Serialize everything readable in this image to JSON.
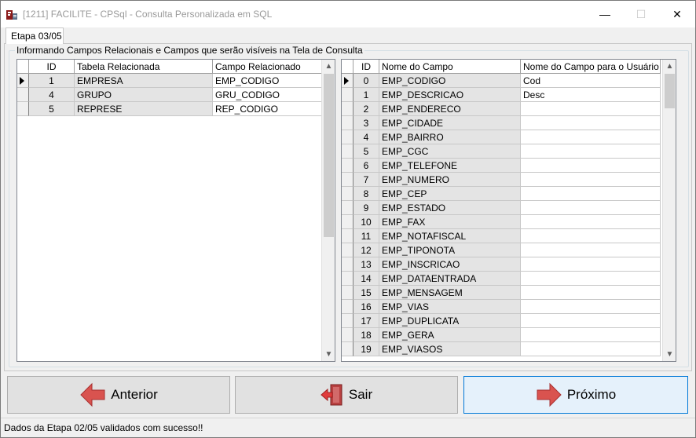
{
  "window": {
    "title": "[1211] FACILITE - CPSql - Consulta Personalizada em SQL",
    "minimize_glyph": "—",
    "maximize_glyph": "☐",
    "close_glyph": "✕",
    "app_icon": "facilite-app-icon"
  },
  "tab": {
    "label": "Etapa 03/05"
  },
  "group": {
    "caption": "Informando Campos Relacionais e Campos que serão visíveis na Tela de Consulta"
  },
  "left_grid": {
    "headers": [
      "ID",
      "Tabela Relacionada",
      "Campo Relacionado"
    ],
    "rows": [
      {
        "id": "1",
        "tabela": "EMPRESA",
        "campo": "EMP_CODIGO",
        "current": true
      },
      {
        "id": "4",
        "tabela": "GRUPO",
        "campo": "GRU_CODIGO",
        "current": false
      },
      {
        "id": "5",
        "tabela": "REPRESE",
        "campo": "REP_CODIGO",
        "current": false
      }
    ]
  },
  "right_grid": {
    "headers": [
      "ID",
      "Nome do Campo",
      "Nome do Campo para o Usuário"
    ],
    "rows": [
      {
        "id": "0",
        "nome": "EMP_CODIGO",
        "usuario": "Cod",
        "current": true
      },
      {
        "id": "1",
        "nome": "EMP_DESCRICAO",
        "usuario": "Desc",
        "current": false
      },
      {
        "id": "2",
        "nome": "EMP_ENDERECO",
        "usuario": "",
        "current": false
      },
      {
        "id": "3",
        "nome": "EMP_CIDADE",
        "usuario": "",
        "current": false
      },
      {
        "id": "4",
        "nome": "EMP_BAIRRO",
        "usuario": "",
        "current": false
      },
      {
        "id": "5",
        "nome": "EMP_CGC",
        "usuario": "",
        "current": false
      },
      {
        "id": "6",
        "nome": "EMP_TELEFONE",
        "usuario": "",
        "current": false
      },
      {
        "id": "7",
        "nome": "EMP_NUMERO",
        "usuario": "",
        "current": false
      },
      {
        "id": "8",
        "nome": "EMP_CEP",
        "usuario": "",
        "current": false
      },
      {
        "id": "9",
        "nome": "EMP_ESTADO",
        "usuario": "",
        "current": false
      },
      {
        "id": "10",
        "nome": "EMP_FAX",
        "usuario": "",
        "current": false
      },
      {
        "id": "11",
        "nome": "EMP_NOTAFISCAL",
        "usuario": "",
        "current": false
      },
      {
        "id": "12",
        "nome": "EMP_TIPONOTA",
        "usuario": "",
        "current": false
      },
      {
        "id": "13",
        "nome": "EMP_INSCRICAO",
        "usuario": "",
        "current": false
      },
      {
        "id": "14",
        "nome": "EMP_DATAENTRADA",
        "usuario": "",
        "current": false
      },
      {
        "id": "15",
        "nome": "EMP_MENSAGEM",
        "usuario": "",
        "current": false
      },
      {
        "id": "16",
        "nome": "EMP_VIAS",
        "usuario": "",
        "current": false
      },
      {
        "id": "17",
        "nome": "EMP_DUPLICATA",
        "usuario": "",
        "current": false
      },
      {
        "id": "18",
        "nome": "EMP_GERA",
        "usuario": "",
        "current": false
      },
      {
        "id": "19",
        "nome": "EMP_VIASOS",
        "usuario": "",
        "current": false
      }
    ]
  },
  "buttons": {
    "anterior": {
      "label": "Anterior",
      "icon": "arrow-left-icon"
    },
    "sair": {
      "label": "Sair",
      "icon": "exit-door-icon"
    },
    "proximo": {
      "label": "Próximo",
      "icon": "arrow-right-icon"
    }
  },
  "status": {
    "text": "Dados da Etapa 02/05 validados com sucesso!!"
  },
  "colors": {
    "arrow_red": "#d9534f",
    "focus_blue": "#0078d7",
    "grid_gray": "#e4e4e4"
  }
}
